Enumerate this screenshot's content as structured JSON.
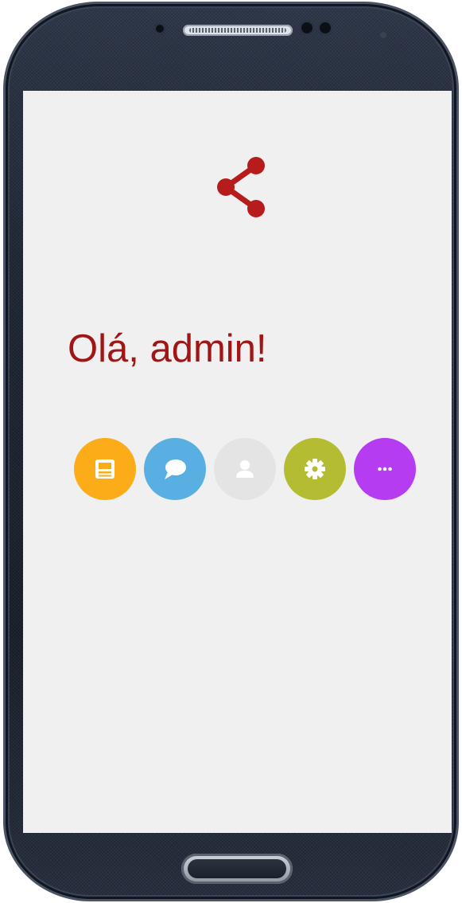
{
  "app": {
    "greeting": "Olá, admin!",
    "brand_icon": "share-icon",
    "brand_color": "#b71c1c"
  },
  "shortcuts": [
    {
      "icon": "news-icon",
      "color": "#fbac18"
    },
    {
      "icon": "chat-icon",
      "color": "#59afe1"
    },
    {
      "icon": "user-icon",
      "color": "#e4e4e4"
    },
    {
      "icon": "gear-icon",
      "color": "#b4bd31"
    },
    {
      "icon": "more-icon",
      "color": "#b63cf2"
    }
  ]
}
